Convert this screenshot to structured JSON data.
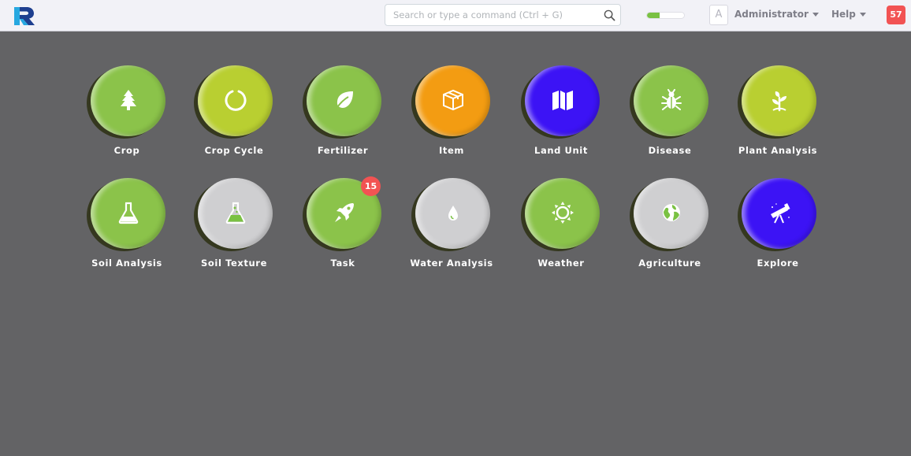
{
  "navbar": {
    "logo_letter": "R",
    "search": {
      "placeholder": "Search or type a command (Ctrl + G)",
      "value": ""
    },
    "progress": {
      "fraction": 0.35,
      "color": "#7ac143"
    },
    "avatar_letter": "A",
    "user_label": "Administrator",
    "help_label": "Help",
    "notifications_count": "57"
  },
  "colors": {
    "green": "#8bc34a",
    "lime": "#b9cf31",
    "orange": "#f39c12",
    "blue": "#3c13f5",
    "gray": "#cfcfd1",
    "badge_red": "#f25353"
  },
  "modules": [
    {
      "label": "Crop",
      "icon": "tree-icon",
      "color": "green"
    },
    {
      "label": "Crop Cycle",
      "icon": "circle-icon",
      "color": "lime"
    },
    {
      "label": "Fertilizer",
      "icon": "leaf-icon",
      "color": "green"
    },
    {
      "label": "Item",
      "icon": "box-icon",
      "color": "orange"
    },
    {
      "label": "Land Unit",
      "icon": "map-icon",
      "color": "blue"
    },
    {
      "label": "Disease",
      "icon": "bug-icon",
      "color": "green"
    },
    {
      "label": "Plant Analysis",
      "icon": "seedling-icon",
      "color": "lime"
    },
    {
      "label": "Soil Analysis",
      "icon": "flask-icon",
      "color": "green"
    },
    {
      "label": "Soil Texture",
      "icon": "flask-fill-icon",
      "color": "gray"
    },
    {
      "label": "Task",
      "icon": "rocket-icon",
      "color": "green",
      "badge": "15"
    },
    {
      "label": "Water Analysis",
      "icon": "droplet-icon",
      "color": "gray"
    },
    {
      "label": "Weather",
      "icon": "sun-icon",
      "color": "green"
    },
    {
      "label": "Agriculture",
      "icon": "globe-icon",
      "color": "gray"
    },
    {
      "label": "Explore",
      "icon": "telescope-icon",
      "color": "blue"
    }
  ]
}
